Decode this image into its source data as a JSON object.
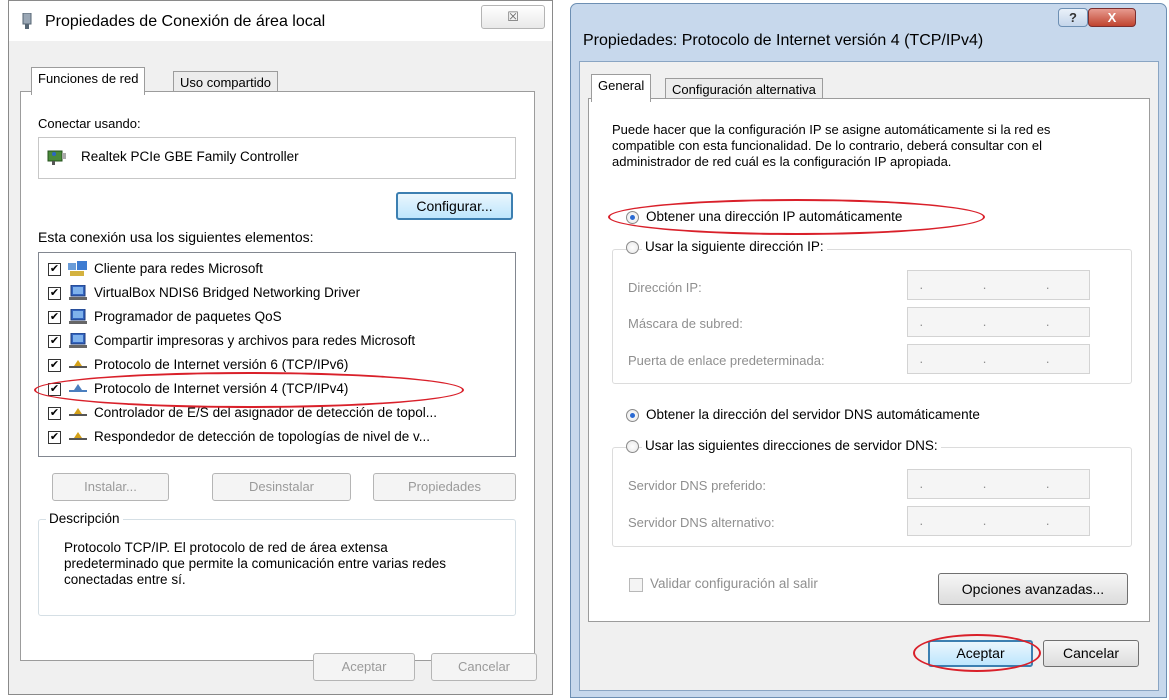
{
  "colors": {
    "annotation": "#d9202a",
    "focus": "#3c7fb1",
    "title_bar_aero": "#c7d8ec"
  },
  "window1": {
    "title": "Propiedades de Conexión de área local",
    "close_label": "☒",
    "tabs": [
      "Funciones de red",
      "Uso compartido"
    ],
    "connect_using_label": "Conectar usando:",
    "adapter_name": "Realtek PCIe GBE Family Controller",
    "configure_button": "Configurar...",
    "elements_label": "Esta conexión usa los siguientes elementos:",
    "items": [
      {
        "label": "Cliente para redes Microsoft",
        "checked": "✔",
        "icon": "network-client-icon"
      },
      {
        "label": "VirtualBox NDIS6 Bridged Networking Driver",
        "checked": "✔",
        "icon": "service-icon"
      },
      {
        "label": "Programador de paquetes QoS",
        "checked": "✔",
        "icon": "service-icon"
      },
      {
        "label": "Compartir impresoras y archivos para redes Microsoft",
        "checked": "✔",
        "icon": "service-icon"
      },
      {
        "label": "Protocolo de Internet versión 6 (TCP/IPv6)",
        "checked": "✔",
        "icon": "protocol-icon"
      },
      {
        "label": "Protocolo de Internet versión 4 (TCP/IPv4)",
        "checked": "✔",
        "icon": "protocol-icon"
      },
      {
        "label": "Controlador de E/S del asignador de detección de topol...",
        "checked": "✔",
        "icon": "protocol-icon"
      },
      {
        "label": "Respondedor de detección de topologías de nivel de v...",
        "checked": "✔",
        "icon": "protocol-icon"
      }
    ],
    "install_button": "Instalar...",
    "uninstall_button": "Desinstalar",
    "properties_button": "Propiedades",
    "description_legend": "Descripción",
    "description_text": "Protocolo TCP/IP. El protocolo de red de área extensa predeterminado que permite la comunicación entre varias redes conectadas entre sí.",
    "ok_button": "Aceptar",
    "cancel_button": "Cancelar"
  },
  "window2": {
    "title": "Propiedades: Protocolo de Internet versión 4 (TCP/IPv4)",
    "help_label": "?",
    "close_label": "X",
    "tabs": [
      "General",
      "Configuración alternativa"
    ],
    "intro": "Puede hacer que la configuración IP se asigne automáticamente si la red es compatible con esta funcionalidad. De lo contrario, deberá consultar con el administrador de red cuál es la configuración IP apropiada.",
    "auto_ip_label": "Obtener una dirección IP automáticamente",
    "manual_ip_label": "Usar la siguiente dirección IP:",
    "ip_fields": [
      {
        "label": "Dirección IP:",
        "value": ". . ."
      },
      {
        "label": "Máscara de subred:",
        "value": ". . ."
      },
      {
        "label": "Puerta de enlace predeterminada:",
        "value": ". . ."
      }
    ],
    "auto_dns_label": "Obtener la dirección del servidor DNS automáticamente",
    "manual_dns_label": "Usar las siguientes direcciones de servidor DNS:",
    "dns_fields": [
      {
        "label": "Servidor DNS preferido:",
        "value": ". . ."
      },
      {
        "label": "Servidor DNS alternativo:",
        "value": ". . ."
      }
    ],
    "validate_label": "Validar configuración al salir",
    "advanced_button": "Opciones avanzadas...",
    "ok_button": "Aceptar",
    "cancel_button": "Cancelar"
  }
}
